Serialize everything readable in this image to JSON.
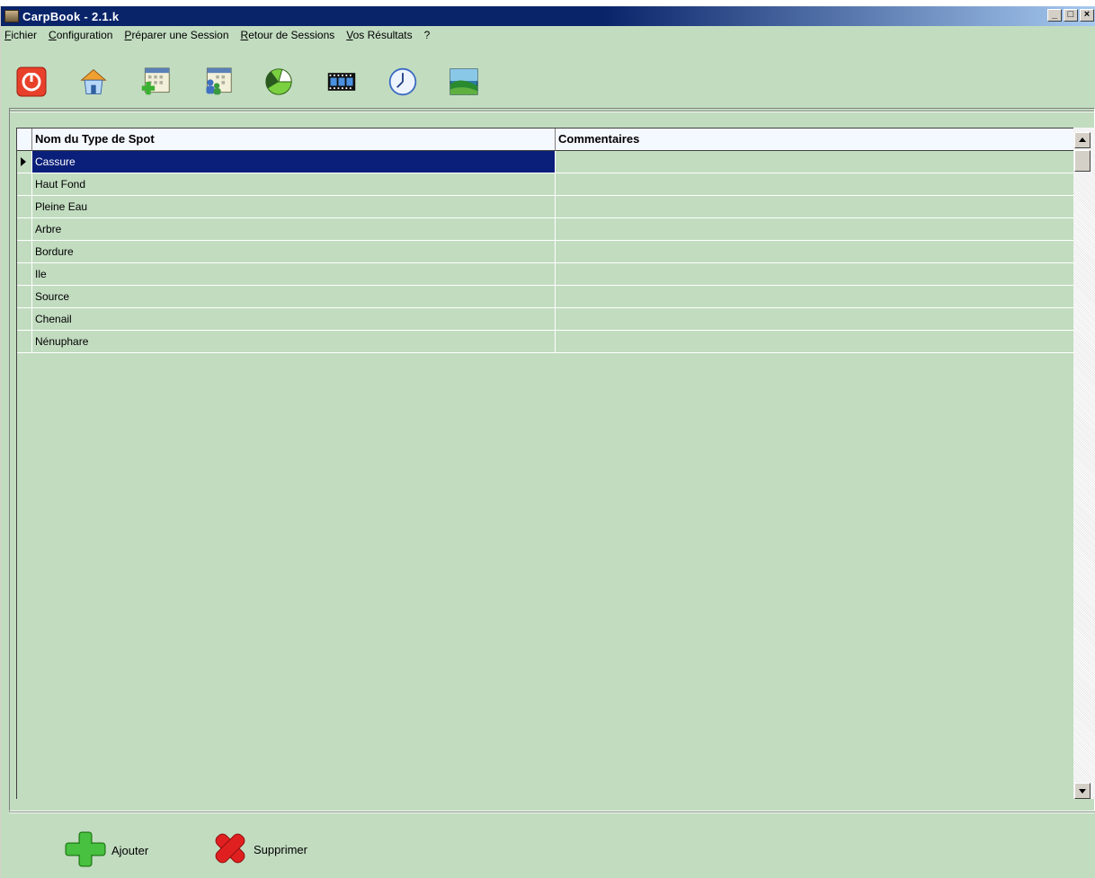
{
  "window": {
    "title": "CarpBook - 2.1.k"
  },
  "menu": [
    {
      "ul": "F",
      "rest": "ichier"
    },
    {
      "ul": "C",
      "rest": "onfiguration"
    },
    {
      "ul": "P",
      "rest": "réparer une Session"
    },
    {
      "ul": "R",
      "rest": "etour de Sessions"
    },
    {
      "ul": "V",
      "rest": "os Résultats"
    },
    {
      "ul": "",
      "rest": "?"
    }
  ],
  "toolbar": {
    "icons": [
      "power-icon",
      "house-icon",
      "calendar-add-icon",
      "calendar-people-icon",
      "pie-chart-icon",
      "film-icon",
      "clock-icon",
      "landscape-image-icon"
    ]
  },
  "grid": {
    "columns": [
      "Nom du Type de Spot",
      "Commentaires"
    ],
    "rows": [
      {
        "name": "Cassure",
        "comment": ""
      },
      {
        "name": "Haut Fond",
        "comment": ""
      },
      {
        "name": "Pleine Eau",
        "comment": ""
      },
      {
        "name": "Arbre",
        "comment": ""
      },
      {
        "name": "Bordure",
        "comment": ""
      },
      {
        "name": "Ile",
        "comment": ""
      },
      {
        "name": "Source",
        "comment": ""
      },
      {
        "name": "Chenail",
        "comment": ""
      },
      {
        "name": "Nénuphare",
        "comment": ""
      }
    ],
    "selected_row": 0
  },
  "actions": {
    "add_label": "Ajouter",
    "delete_label": "Supprimer"
  },
  "colors": {
    "background": "#c2dcc0",
    "selection": "#0a1f7a",
    "titlebar": "#0a246a"
  }
}
